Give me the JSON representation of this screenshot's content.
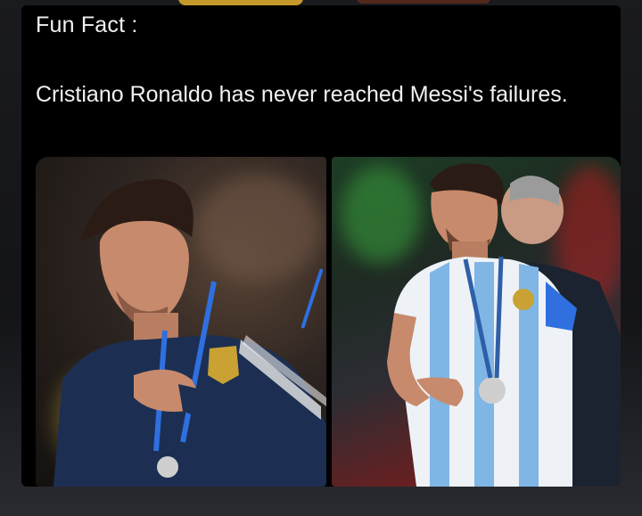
{
  "post": {
    "label": "Fun Fact :",
    "text": "Cristiano Ronaldo has never reached Messi's failures."
  },
  "images": [
    {
      "name": "left-photo",
      "description_icon": "player-photo"
    },
    {
      "name": "right-photo",
      "description_icon": "player-photo"
    }
  ],
  "colors": {
    "background": "#121316",
    "card": "#000000",
    "text": "#f1f1f1",
    "accent_blue": "#2f6fe0"
  }
}
